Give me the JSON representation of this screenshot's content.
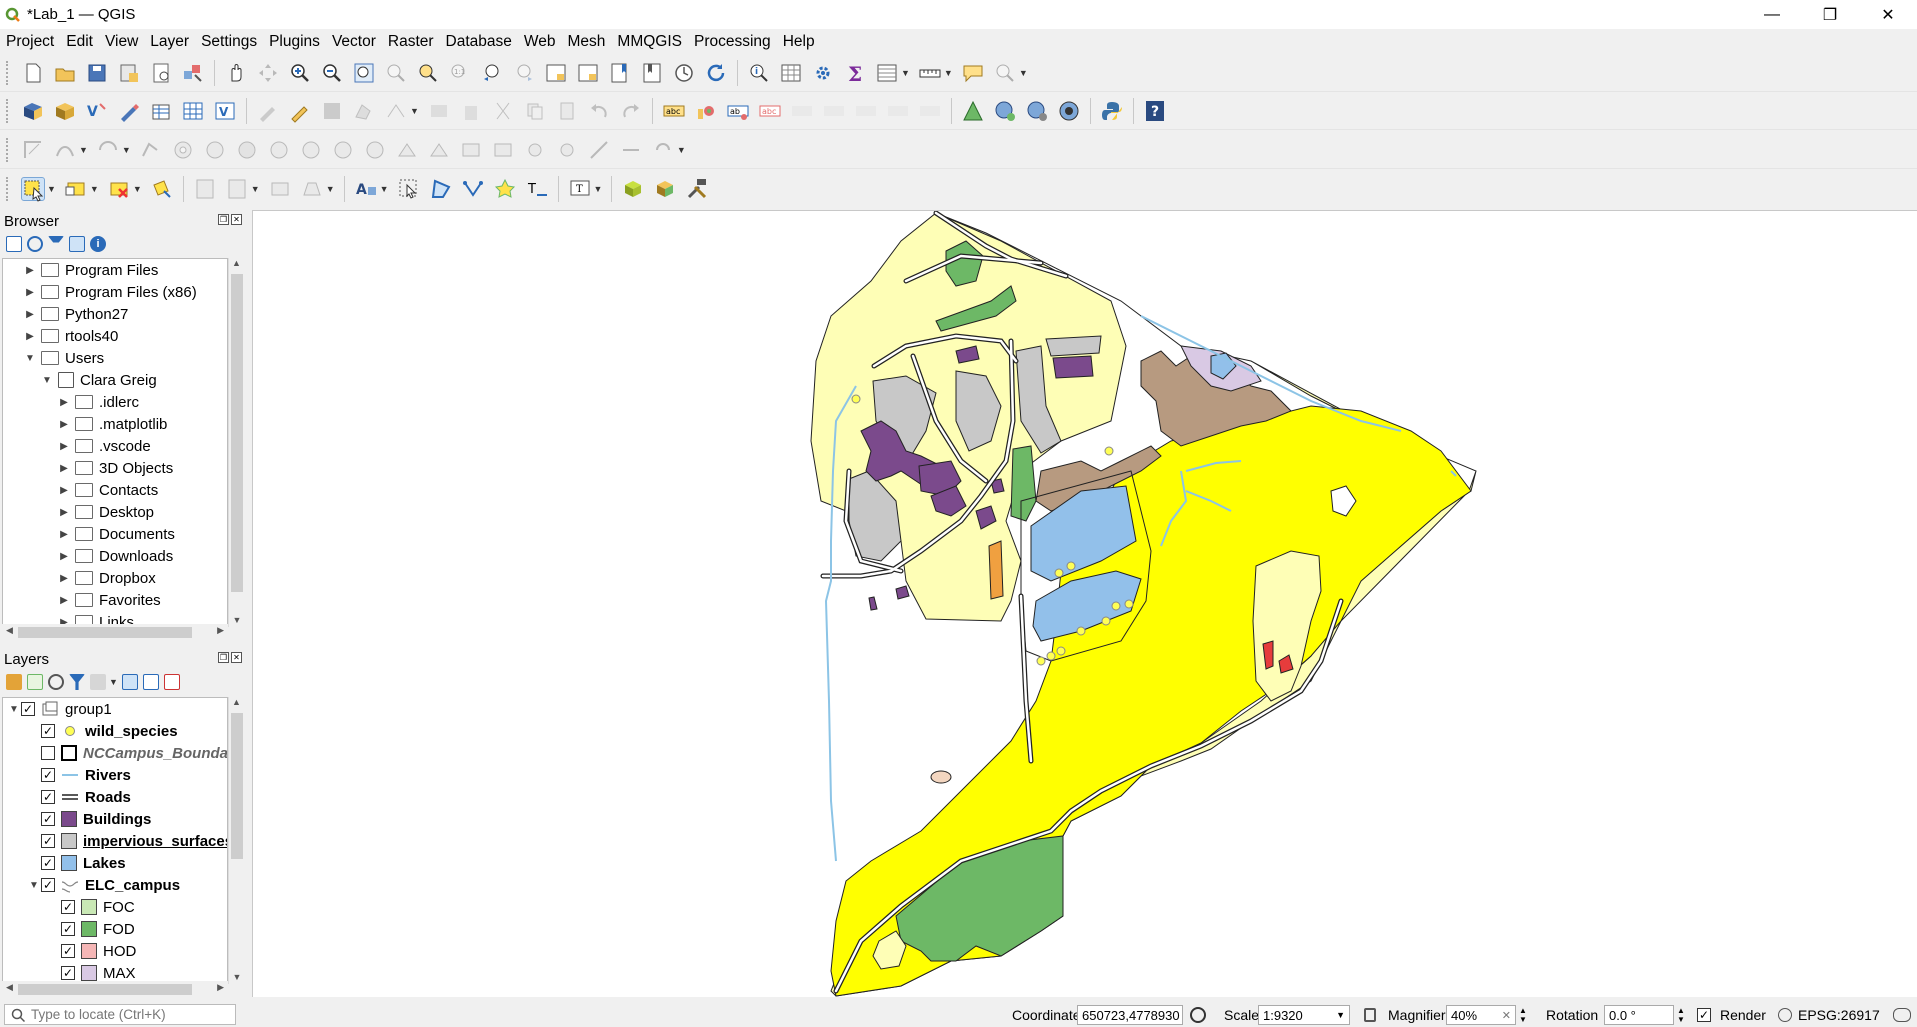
{
  "window": {
    "title": "*Lab_1 — QGIS",
    "min": "—",
    "max": "❐",
    "close": "✕"
  },
  "menu": [
    "Project",
    "Edit",
    "View",
    "Layer",
    "Settings",
    "Plugins",
    "Vector",
    "Raster",
    "Database",
    "Web",
    "Mesh",
    "MMQGIS",
    "Processing",
    "Help"
  ],
  "browser": {
    "title": "Browser",
    "items": [
      {
        "label": "Program Files",
        "level": 0,
        "arrow": "▶",
        "home": false
      },
      {
        "label": "Program Files (x86)",
        "level": 0,
        "arrow": "▶",
        "home": false
      },
      {
        "label": "Python27",
        "level": 0,
        "arrow": "▶",
        "home": false
      },
      {
        "label": "rtools40",
        "level": 0,
        "arrow": "▶",
        "home": false
      },
      {
        "label": "Users",
        "level": 0,
        "arrow": "▼",
        "home": false
      },
      {
        "label": "Clara Greig",
        "level": 1,
        "arrow": "▼",
        "home": true
      },
      {
        "label": ".idlerc",
        "level": 2,
        "arrow": "▶",
        "home": false
      },
      {
        "label": ".matplotlib",
        "level": 2,
        "arrow": "▶",
        "home": false
      },
      {
        "label": ".vscode",
        "level": 2,
        "arrow": "▶",
        "home": false
      },
      {
        "label": "3D Objects",
        "level": 2,
        "arrow": "▶",
        "home": false
      },
      {
        "label": "Contacts",
        "level": 2,
        "arrow": "▶",
        "home": false
      },
      {
        "label": "Desktop",
        "level": 2,
        "arrow": "▶",
        "home": false
      },
      {
        "label": "Documents",
        "level": 2,
        "arrow": "▶",
        "home": false
      },
      {
        "label": "Downloads",
        "level": 2,
        "arrow": "▶",
        "home": false
      },
      {
        "label": "Dropbox",
        "level": 2,
        "arrow": "▶",
        "home": false
      },
      {
        "label": "Favorites",
        "level": 2,
        "arrow": "▶",
        "home": false
      },
      {
        "label": "Links",
        "level": 2,
        "arrow": "▶",
        "home": false
      }
    ]
  },
  "layers": {
    "title": "Layers",
    "items": [
      {
        "label": "group1",
        "level": 0,
        "arrow": "▼",
        "checked": true,
        "sym": "group",
        "bold": false,
        "italic": false,
        "underline": false,
        "color": "#000"
      },
      {
        "label": "wild_species",
        "level": 1,
        "arrow": "",
        "checked": true,
        "sym": "point",
        "bold": true,
        "italic": false,
        "underline": false,
        "color": "#000"
      },
      {
        "label": "NCCampus_Boundary",
        "level": 1,
        "arrow": "",
        "checked": false,
        "sym": "outline",
        "bold": true,
        "italic": true,
        "underline": false,
        "color": "#666"
      },
      {
        "label": "Rivers",
        "level": 1,
        "arrow": "",
        "checked": true,
        "sym": "line",
        "bold": true,
        "italic": false,
        "underline": false,
        "color": "#000"
      },
      {
        "label": "Roads",
        "level": 1,
        "arrow": "",
        "checked": true,
        "sym": "road",
        "bold": true,
        "italic": false,
        "underline": false,
        "color": "#000"
      },
      {
        "label": "Buildings",
        "level": 1,
        "arrow": "",
        "checked": true,
        "sym": "fill",
        "fill": "#7b4a8c",
        "bold": true,
        "italic": false,
        "underline": false,
        "color": "#000"
      },
      {
        "label": "impervious_surfaces",
        "level": 1,
        "arrow": "",
        "checked": true,
        "sym": "fill",
        "fill": "#c8c8c8",
        "bold": true,
        "italic": false,
        "underline": true,
        "color": "#000"
      },
      {
        "label": "Lakes",
        "level": 1,
        "arrow": "",
        "checked": true,
        "sym": "fill",
        "fill": "#92c0ea",
        "bold": true,
        "italic": false,
        "underline": false,
        "color": "#000"
      },
      {
        "label": "ELC_campus",
        "level": 1,
        "arrow": "▼",
        "checked": true,
        "sym": "group-line",
        "bold": true,
        "italic": false,
        "underline": false,
        "color": "#000"
      },
      {
        "label": "FOC",
        "level": 2,
        "arrow": "",
        "checked": true,
        "sym": "fill",
        "fill": "#c9e8b5",
        "bold": false,
        "italic": false,
        "underline": false,
        "color": "#000"
      },
      {
        "label": "FOD",
        "level": 2,
        "arrow": "",
        "checked": true,
        "sym": "fill",
        "fill": "#6db866",
        "bold": false,
        "italic": false,
        "underline": false,
        "color": "#000"
      },
      {
        "label": "HOD",
        "level": 2,
        "arrow": "",
        "checked": true,
        "sym": "fill",
        "fill": "#f5b6b6",
        "bold": false,
        "italic": false,
        "underline": false,
        "color": "#000"
      },
      {
        "label": "MAX",
        "level": 2,
        "arrow": "",
        "checked": true,
        "sym": "fill",
        "fill": "#d9c9e4",
        "bold": false,
        "italic": false,
        "underline": false,
        "color": "#000"
      }
    ]
  },
  "status": {
    "locator_placeholder": "Type to locate (Ctrl+K)",
    "coordinate_label": "Coordinate",
    "coordinate_value": "650723,4778930",
    "scale_label": "Scale",
    "scale_value": "1:9320",
    "magnifier_label": "Magnifier",
    "magnifier_value": "40%",
    "rotation_label": "Rotation",
    "rotation_value": "0.0 °",
    "render_label": "Render",
    "crs": "EPSG:26917"
  },
  "colors": {
    "yellow": "#ffff00",
    "cream": "#fefeb6",
    "building": "#7b4a8c",
    "impervious": "#c8c8c8",
    "lake": "#92c0ea",
    "river": "#8cc4e6",
    "forest": "#6db866",
    "brown": "#b79a80",
    "lavender": "#d9c9e4",
    "orange": "#f0a040",
    "red": "#e63c3c"
  }
}
